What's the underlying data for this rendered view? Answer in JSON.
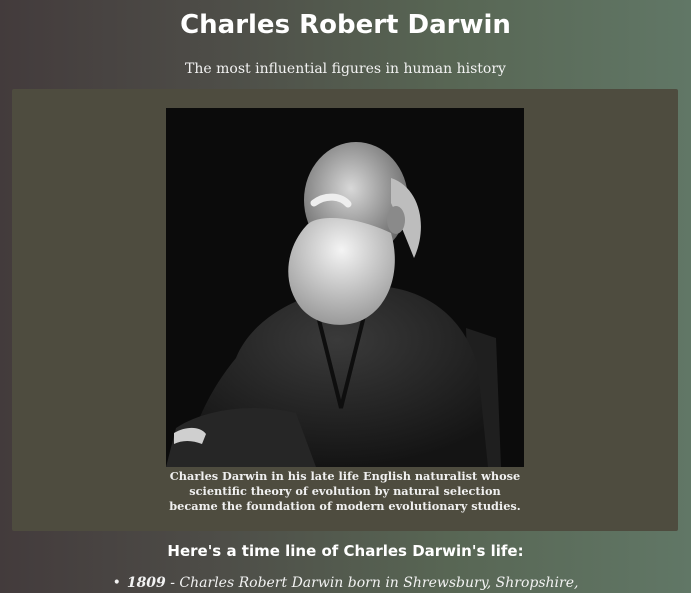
{
  "header": {
    "title": "Charles Robert Darwin",
    "subtitle": "The most influential figures in human history"
  },
  "figure": {
    "image_alt": "Portrait photograph of Charles Darwin",
    "caption": "Charles Darwin in his late life English naturalist whose scientific theory of evolution by natural selection became the foundation of modern evolutionary studies."
  },
  "timeline": {
    "heading": "Here's a time line of Charles Darwin's life:",
    "items": [
      {
        "bullet": "•",
        "year": "1809",
        "text": " - Charles Robert Darwin born in Shrewsbury, Shropshire,"
      }
    ]
  }
}
